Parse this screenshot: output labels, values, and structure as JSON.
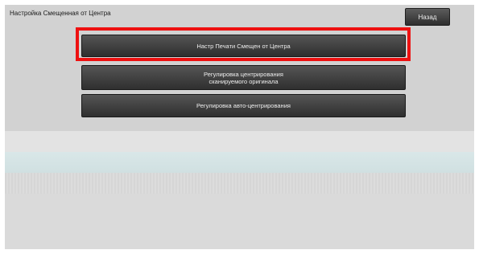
{
  "header": {
    "title": "Настройка Смещенная от Центра",
    "back_label": "Назад"
  },
  "menu": {
    "print_offset": "Настр Печати Смещен от Центра",
    "scan_center_line1": "Регулировка центрирования",
    "scan_center_line2": "сканируемого оригинала",
    "auto_center": "Регулировка авто-центрирования"
  },
  "colors": {
    "highlight": "#ee1111",
    "button_dark": "#333333"
  }
}
